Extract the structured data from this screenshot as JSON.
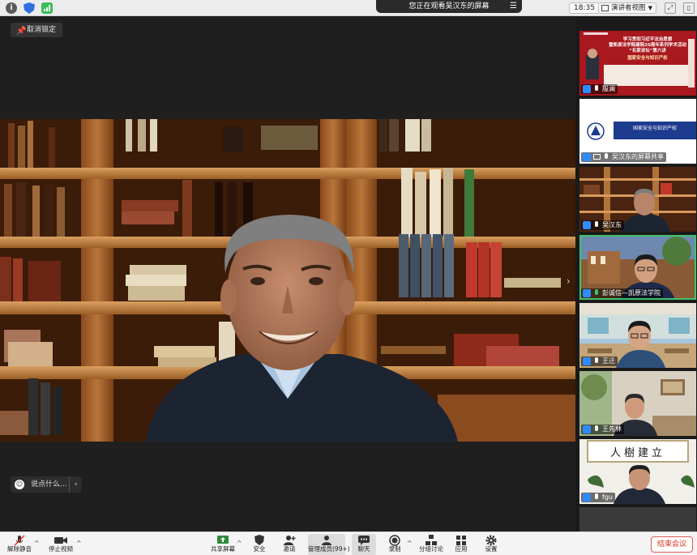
{
  "topbar": {
    "banner": "您正在观看吴汉东的屏幕",
    "clock": "18:35",
    "view_mode": "演讲者视图",
    "info_icon": "info-icon",
    "security_icon": "shield-icon",
    "signal_icon": "signal-icon"
  },
  "stage": {
    "unlock_label": "取消锁定",
    "chat_placeholder": "说点什么..."
  },
  "slide": {
    "title_lines": [
      "学习贯彻习近平法治思想",
      "暨凯原法学院建院20周年系列学术活动",
      "“名家讲坛”第六讲"
    ],
    "subtitle": "国家安全与知识产权",
    "share_title": "国家安全与知识产权"
  },
  "participants": [
    {
      "name": "殷澜",
      "speaking": false
    },
    {
      "name": "吴汉东的屏幕共享",
      "speaking": false
    },
    {
      "name": "吴汉东",
      "speaking": false
    },
    {
      "name": "彭诚信—凯原法学院",
      "speaking": true
    },
    {
      "name": "王迁",
      "speaking": false
    },
    {
      "name": "王先林",
      "speaking": false
    },
    {
      "name": "fgu",
      "speaking": false
    }
  ],
  "calligraphy": "人樹建立",
  "toolbar": {
    "unmute": "解除静音",
    "stop_video": "停止视频",
    "share_screen": "共享屏幕",
    "security": "安全",
    "invite": "邀请",
    "manage_members": "管理成员(99+)",
    "chat": "聊天",
    "record": "录制",
    "breakout": "分组讨论",
    "apps": "应用",
    "settings": "设置",
    "end_meeting": "结束会议"
  },
  "colors": {
    "accent_green": "#3fc36a",
    "end_red": "#e02d1f",
    "slide_red": "#a8181e"
  }
}
